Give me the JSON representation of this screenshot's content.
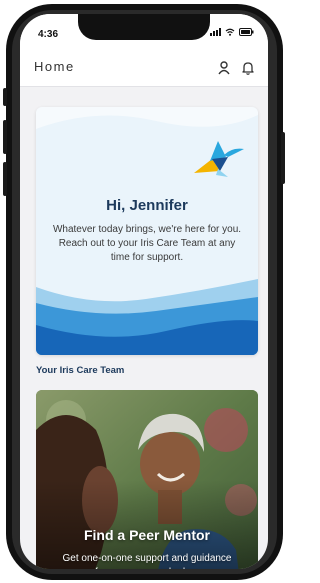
{
  "status_bar": {
    "time": "4:36",
    "icons": [
      "signal-icon",
      "wifi-icon",
      "battery-icon"
    ]
  },
  "header": {
    "title": "Home",
    "icons": [
      "profile-icon",
      "notification-bell-icon"
    ]
  },
  "welcome_card": {
    "greeting": "Hi, Jennifer",
    "message": "Whatever today brings, we're here for you. Reach out to your Iris Care Team at any time for support.",
    "illustration": "hummingbird-logo"
  },
  "care_team_section": {
    "title": "Your Iris Care Team"
  },
  "mentor_card": {
    "title": "Find a Peer Mentor",
    "description": "Get one-on-one support and guidance from someone who has"
  },
  "colors": {
    "navy": "#1d3a5c",
    "wave_blue": "#1a73c8",
    "light_blue": "#cfe6f6",
    "bird_yellow": "#f4b400"
  }
}
